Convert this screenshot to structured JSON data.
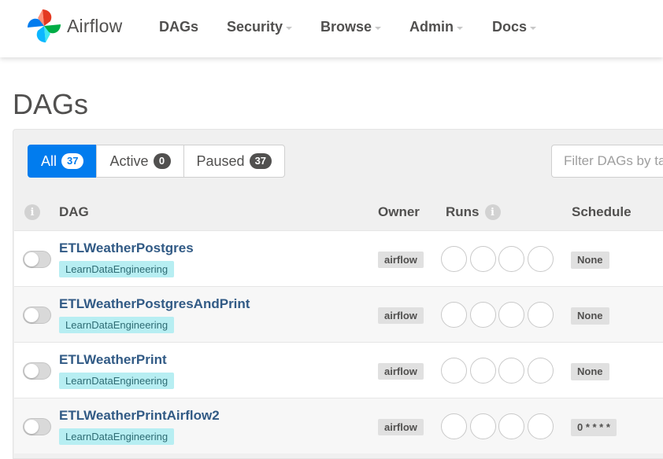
{
  "brand": {
    "name": "Airflow"
  },
  "nav": {
    "items": [
      {
        "label": "DAGs",
        "dropdown": false
      },
      {
        "label": "Security",
        "dropdown": true
      },
      {
        "label": "Browse",
        "dropdown": true
      },
      {
        "label": "Admin",
        "dropdown": true
      },
      {
        "label": "Docs",
        "dropdown": true
      }
    ]
  },
  "page": {
    "title": "DAGs"
  },
  "filters": {
    "all": {
      "label": "All",
      "count": "37"
    },
    "active": {
      "label": "Active",
      "count": "0"
    },
    "paused": {
      "label": "Paused",
      "count": "37"
    },
    "search_placeholder": "Filter DAGs by tag"
  },
  "table": {
    "columns": {
      "info_icon": "i",
      "dag": "DAG",
      "owner": "Owner",
      "runs": "Runs",
      "runs_info_icon": "i",
      "schedule": "Schedule"
    },
    "rows": [
      {
        "name": "ETLWeatherPostgres",
        "tag": "LearnDataEngineering",
        "owner": "airflow",
        "schedule": "None"
      },
      {
        "name": "ETLWeatherPostgresAndPrint",
        "tag": "LearnDataEngineering",
        "owner": "airflow",
        "schedule": "None"
      },
      {
        "name": "ETLWeatherPrint",
        "tag": "LearnDataEngineering",
        "owner": "airflow",
        "schedule": "None"
      },
      {
        "name": "ETLWeatherPrintAirflow2",
        "tag": "LearnDataEngineering",
        "owner": "airflow",
        "schedule": "0 * * * *"
      }
    ]
  },
  "colors": {
    "primary": "#017cee",
    "dag_link": "#315a85",
    "tag_bg": "#b7eef2",
    "text": "#51504f"
  }
}
